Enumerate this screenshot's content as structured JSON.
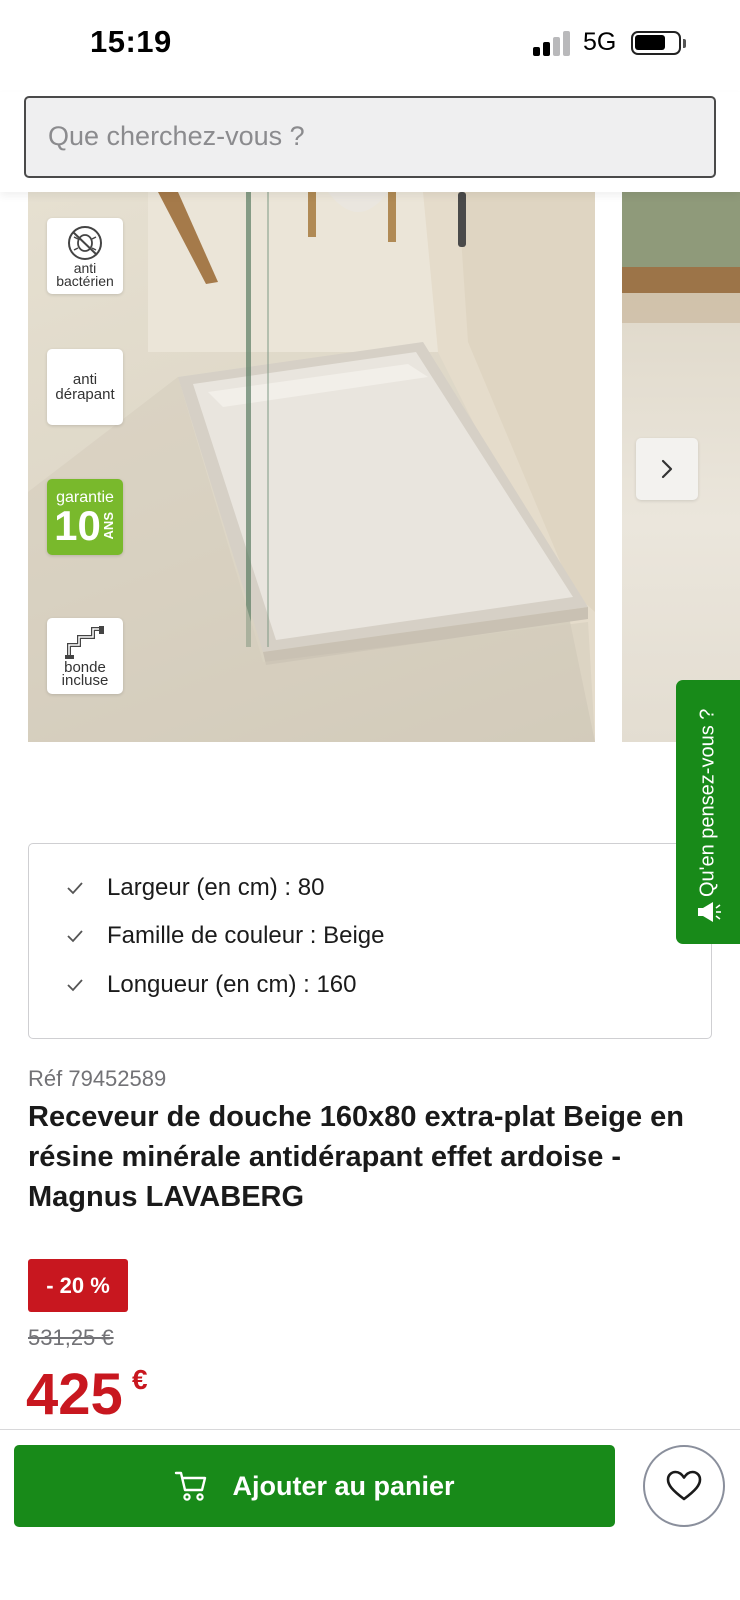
{
  "status_bar": {
    "time": "15:19",
    "network": "5G"
  },
  "search": {
    "placeholder": "Que cherchez-vous ?"
  },
  "gallery": {
    "badges": [
      {
        "icon": "antibacterial-icon",
        "label": "anti\nbactérien"
      },
      {
        "label": "anti\ndérapant"
      },
      {
        "label_top": "garantie",
        "number": "10",
        "unit": "ANS"
      },
      {
        "icon": "drain-pipe-icon",
        "label": "bonde\nincluse"
      }
    ],
    "next_icon": "chevron-right-icon"
  },
  "feedback": {
    "label": "Qu'en pensez-vous ?",
    "icon": "megaphone-icon"
  },
  "specs": [
    {
      "label": "Largeur (en cm) : 80"
    },
    {
      "label": "Famille de couleur : Beige"
    },
    {
      "label": "Longueur (en cm) : 160"
    }
  ],
  "product": {
    "ref": "Réf 79452589",
    "title": "Receveur de douche 160x80 extra-plat Beige en résine minérale antidérapant effet ardoise - Magnus LAVABERG",
    "discount": "- 20 %",
    "old_price": "531,25 €",
    "price": "425",
    "currency": "€"
  },
  "actions": {
    "add_to_cart": "Ajouter au panier",
    "cart_icon": "cart-icon",
    "wishlist_icon": "heart-icon"
  },
  "colors": {
    "brand_green": "#188a19",
    "promo_red": "#c8171f",
    "badge_green": "#79b92c"
  }
}
